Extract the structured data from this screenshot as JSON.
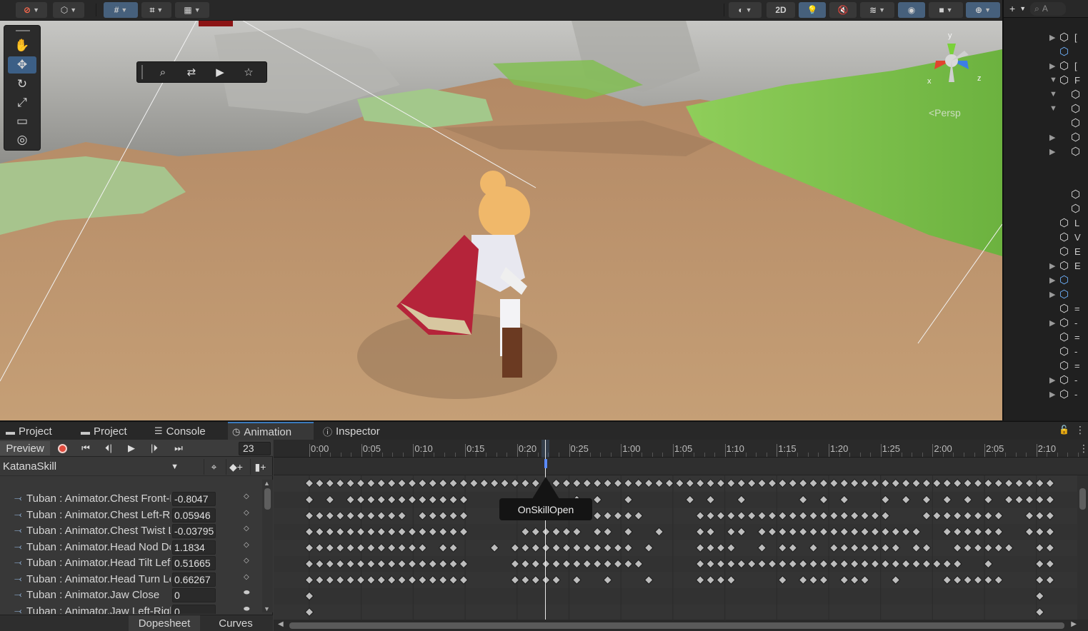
{
  "scene_toolbar": {
    "buttons": [
      "gizmo",
      "draw-mode",
      "grid-snap",
      "snap-increment",
      "rulers"
    ],
    "right_buttons": [
      "shading",
      "2D",
      "lighting",
      "audio",
      "effects",
      "hidden-objects",
      "camera",
      "gizmos"
    ],
    "two_d_label": "2D"
  },
  "scene": {
    "persp_label": "<Persp",
    "gizmo_axes": {
      "y": "y",
      "x": "x",
      "z": "z"
    }
  },
  "hierarchy": {
    "add_label": "+",
    "search_placeholder": "A",
    "item_letters": [
      "[",
      "",
      "[",
      "F",
      "",
      "",
      "",
      "",
      "",
      "",
      "",
      "L",
      "V",
      "E",
      "E",
      "",
      "",
      "=",
      "-",
      "=",
      "-",
      "=",
      "-",
      "-"
    ]
  },
  "tabs": [
    {
      "label": "Project",
      "icon": "folder-icon"
    },
    {
      "label": "Project",
      "icon": "folder-icon"
    },
    {
      "label": "Console",
      "icon": "console-icon"
    },
    {
      "label": "Animation",
      "icon": "clock-icon"
    },
    {
      "label": "Inspector",
      "icon": "info-icon"
    }
  ],
  "animation": {
    "preview_label": "Preview",
    "current_frame": "23",
    "clip_name": "KatanaSkill",
    "properties": [
      {
        "name": "Tuban : Animator.Chest Front-Back",
        "value": "-0.8047"
      },
      {
        "name": "Tuban : Animator.Chest Left-Right",
        "value": "0.05946"
      },
      {
        "name": "Tuban : Animator.Chest Twist Left-Right",
        "value": "-0.03795"
      },
      {
        "name": "Tuban : Animator.Head Nod Down-Up",
        "value": "1.1834"
      },
      {
        "name": "Tuban : Animator.Head Tilt Left-Right",
        "value": "0.51665"
      },
      {
        "name": "Tuban : Animator.Head Turn Left-Right",
        "value": "0.66267"
      },
      {
        "name": "Tuban : Animator.Jaw Close",
        "value": "0"
      },
      {
        "name": "Tuban : Animator.Jaw Left-Right",
        "value": "0"
      }
    ],
    "bottom_tabs": [
      "Dopesheet",
      "Curves"
    ],
    "ruler_labels": [
      "0:00",
      "0:05",
      "0:10",
      "0:15",
      "0:20",
      "0:25",
      "1:00",
      "1:05",
      "1:10",
      "1:15",
      "1:20",
      "1:25",
      "2:00",
      "2:05",
      "2:10"
    ],
    "event_tooltip": "OnSkillOpen"
  }
}
